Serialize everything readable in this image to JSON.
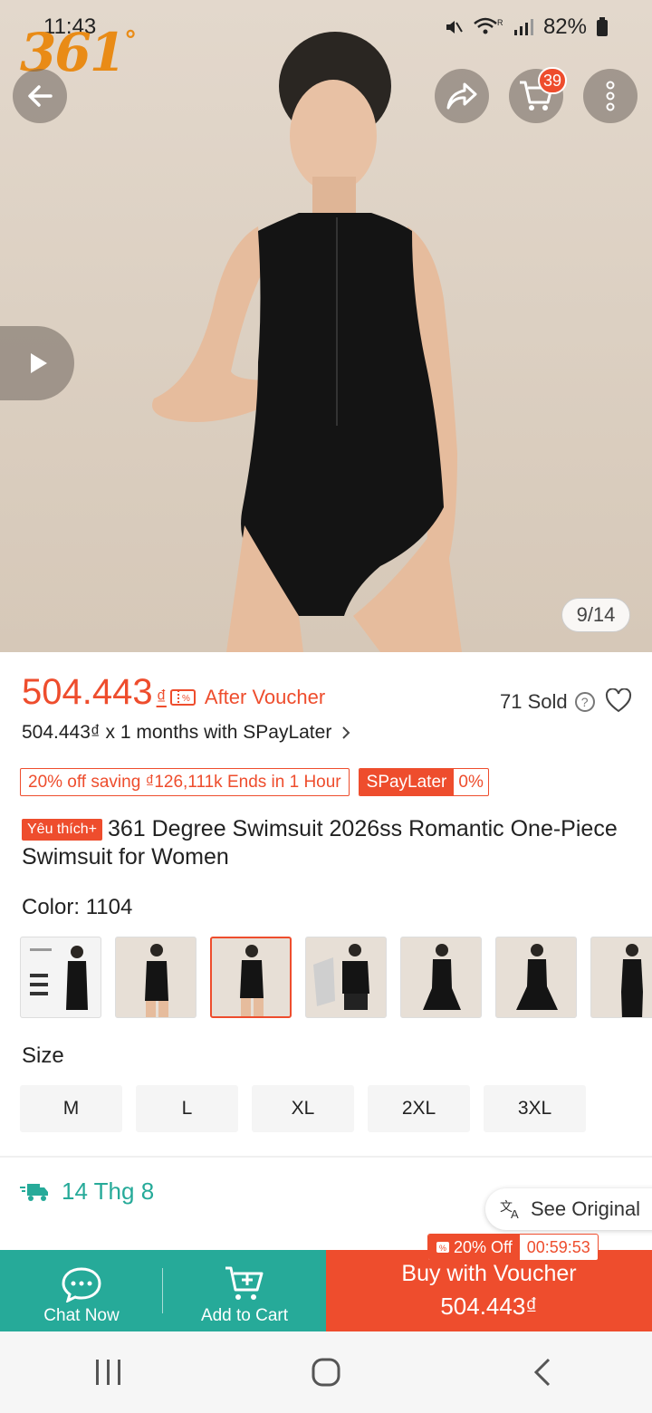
{
  "status": {
    "time": "11:43",
    "battery": "82%"
  },
  "brand": {
    "logo_text": "361",
    "logo_degree": "°"
  },
  "hero": {
    "cart_count": "39",
    "image_counter": "9/14"
  },
  "price": {
    "amount": "504.443",
    "currency": "₫",
    "after_voucher": "After Voucher",
    "installment": "504.443₫ x 1 months with SPayLater",
    "sold": "71 Sold",
    "help": "?"
  },
  "promo": {
    "saving": "20% off saving ₫126,111k Ends in 1 Hour",
    "spaylater_label": "SPayLater",
    "spaylater_rate": "0%"
  },
  "product": {
    "badge": "Yêu thích+",
    "title": "361 Degree Swimsuit 2026ss Romantic One-Piece Swimsuit for Women"
  },
  "variants": {
    "color_label": "Color: 1104",
    "size_label": "Size",
    "sizes": [
      "M",
      "L",
      "XL",
      "2XL",
      "3XL"
    ]
  },
  "shipping": {
    "date": "14 Thg 8"
  },
  "translate": {
    "label": "See Original"
  },
  "bottom": {
    "chat": "Chat Now",
    "cart": "Add to Cart",
    "buy_line1": "Buy with Voucher",
    "buy_line2": "504.443₫",
    "voucher_discount": "20% Off",
    "voucher_timer": "00:59:53"
  },
  "colors": {
    "accent": "#ee4d2d",
    "teal": "#26aa99"
  }
}
